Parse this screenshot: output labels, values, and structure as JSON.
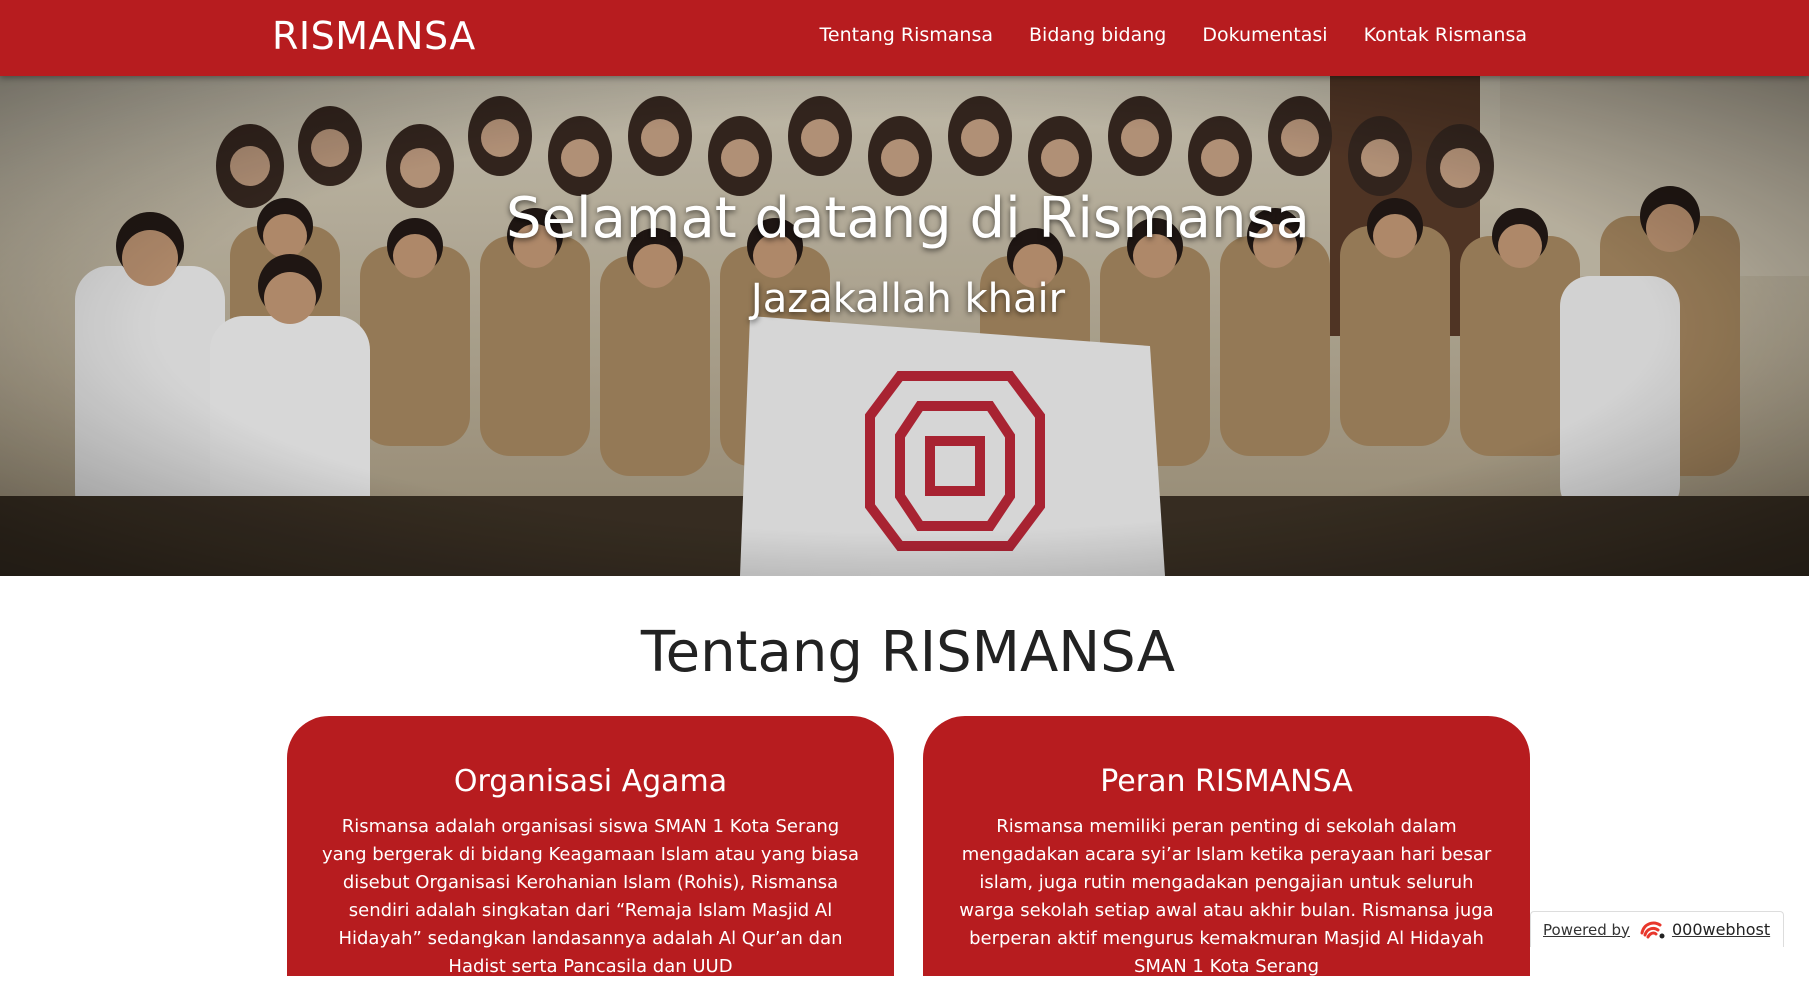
{
  "colors": {
    "primary": "#b71c1f",
    "text_dark": "#222222",
    "white": "#ffffff"
  },
  "navbar": {
    "brand": "RISMANSA",
    "links": [
      {
        "label": "Tentang Rismansa"
      },
      {
        "label": "Bidang bidang"
      },
      {
        "label": "Dokumentasi"
      },
      {
        "label": "Kontak Rismansa"
      }
    ]
  },
  "hero": {
    "title": "Selamat datang di Rismansa",
    "subtitle": "Jazakallah khair"
  },
  "about": {
    "title": "Tentang RISMANSA",
    "cards": [
      {
        "title": "Organisasi Agama",
        "text": "Rismansa adalah organisasi siswa SMAN 1 Kota Serang yang bergerak di bidang Keagamaan Islam atau yang biasa disebut Organisasi Kerohanian Islam (Rohis), Rismansa sendiri adalah singkatan dari “Remaja Islam Masjid Al Hidayah” sedangkan landasannya adalah Al Qur’an dan Hadist serta Pancasila dan UUD"
      },
      {
        "title": "Peran RISMANSA",
        "text": "Rismansa memiliki peran penting di sekolah dalam mengadakan acara syi’ar Islam ketika perayaan hari besar islam, juga rutin mengadakan pengajian untuk seluruh warga sekolah setiap awal atau akhir bulan. Rismansa juga berperan aktif mengurus kemakmuran Masjid Al Hidayah SMAN 1 Kota Serang"
      }
    ]
  },
  "powered_by": {
    "label": "Powered by",
    "brand": "000webhost",
    "icon": "000webhost-logo-icon"
  }
}
